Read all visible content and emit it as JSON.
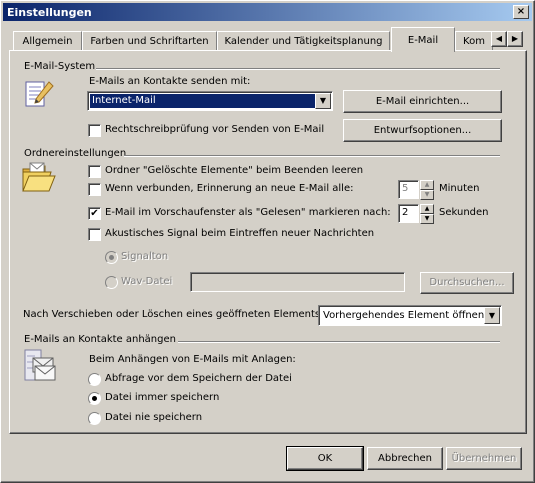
{
  "window": {
    "title": "Einstellungen",
    "close": "×"
  },
  "tabs": [
    {
      "label": "Allgemein"
    },
    {
      "label": "Farben und Schriftarten"
    },
    {
      "label": "Kalender und Tätigkeitsplanung"
    },
    {
      "label": "E-Mail"
    },
    {
      "label": "Kom"
    }
  ],
  "tab_scroll": {
    "left": "◀",
    "right": "▶"
  },
  "email_system": {
    "heading": "E-Mail-System",
    "send_label": "E-Mails an Kontakte senden mit:",
    "send_value": "Internet-Mail",
    "setup_button": "E-Mail einrichten...",
    "spellcheck_label": "Rechtschreibprüfung vor Senden von E-Mail",
    "spellcheck_checked": false,
    "draft_button": "Entwurfsoptionen..."
  },
  "folder_settings": {
    "heading": "Ordnereinstellungen",
    "empty_deleted_label": "Ordner \"Gelöschte Elemente\" beim Beenden leeren",
    "empty_deleted_checked": false,
    "reminder_label": "Wenn verbunden, Erinnerung an neue E-Mail alle:",
    "reminder_checked": false,
    "reminder_value": "5",
    "reminder_unit": "Minuten",
    "mark_read_label": "E-Mail im Vorschaufenster als \"Gelesen\" markieren nach:",
    "mark_read_checked": true,
    "mark_read_value": "2",
    "mark_read_unit": "Sekunden",
    "sound_label": "Akustisches Signal beim Eintreffen neuer Nachrichten",
    "sound_checked": false,
    "signal_label": "Signalton",
    "wav_label": "Wav-Datei",
    "wav_value": "",
    "browse_button": "Durchsuchen..."
  },
  "after_move": {
    "label": "Nach Verschieben oder Löschen eines geöffneten Elements:",
    "value": "Vorhergehendes Element öffnen"
  },
  "attach": {
    "heading": "E-Mails an Kontakte anhängen",
    "prompt": "Beim Anhängen von E-Mails mit Anlagen:",
    "options": [
      {
        "label": "Abfrage vor dem Speichern der Datei",
        "selected": false
      },
      {
        "label": "Datei immer speichern",
        "selected": true
      },
      {
        "label": "Datei nie speichern",
        "selected": false
      }
    ]
  },
  "footer": {
    "ok": "OK",
    "cancel": "Abbrechen",
    "apply": "Übernehmen"
  },
  "icons": {
    "email_system": "pen-paper-icon",
    "folder": "open-folder-icon",
    "attach": "envelope-stack-icon",
    "dropdown": "▼",
    "spin_up": "▲",
    "spin_down": "▼",
    "check": "✔"
  }
}
